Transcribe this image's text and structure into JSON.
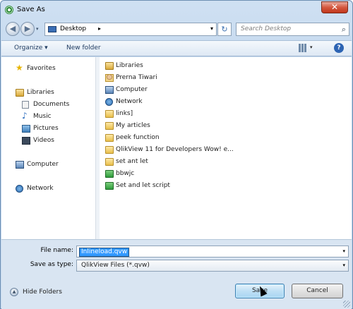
{
  "window": {
    "title": "Save As",
    "close_glyph": "✕"
  },
  "address_bar": {
    "location": "Desktop",
    "breadcrumb_arrow": "▸",
    "dropdown_glyph": "▾",
    "refresh_glyph": "↻",
    "search_placeholder": "Search Desktop",
    "back_glyph": "◀",
    "forward_glyph": "▶"
  },
  "toolbar": {
    "organize_label": "Organize ▾",
    "new_folder_label": "New folder",
    "views_dropdown_glyph": "▾",
    "help_glyph": "?"
  },
  "nav_pane": {
    "favorites": {
      "label": "Favorites",
      "icon": "star-icon"
    },
    "libraries": {
      "label": "Libraries",
      "icon": "library-icon"
    },
    "library_items": [
      {
        "label": "Documents",
        "icon": "documents-icon"
      },
      {
        "label": "Music",
        "icon": "music-icon"
      },
      {
        "label": "Pictures",
        "icon": "pictures-icon"
      },
      {
        "label": "Videos",
        "icon": "videos-icon"
      }
    ],
    "computer": {
      "label": "Computer",
      "icon": "computer-icon"
    },
    "network": {
      "label": "Network",
      "icon": "network-icon"
    }
  },
  "files": [
    {
      "label": "Libraries",
      "icon": "library-icon"
    },
    {
      "label": "Prerna Tiwari",
      "icon": "user-folder-icon"
    },
    {
      "label": "Computer",
      "icon": "computer-icon"
    },
    {
      "label": "Network",
      "icon": "network-icon"
    },
    {
      "label": "links]",
      "icon": "folder-icon"
    },
    {
      "label": "My articles",
      "icon": "folder-icon"
    },
    {
      "label": "peek function",
      "icon": "folder-icon"
    },
    {
      "label": "QlikView 11 for Developers   Wow! e...",
      "icon": "folder-icon"
    },
    {
      "label": "set ant let",
      "icon": "folder-icon"
    },
    {
      "label": "bbwjc",
      "icon": "qvw-file-icon"
    },
    {
      "label": "Set and let script",
      "icon": "qvw-file-icon"
    }
  ],
  "form": {
    "file_name_label": "File name:",
    "file_name_value": "Inlineload.qvw",
    "save_type_label": "Save as type:",
    "save_type_value": "QlikView Files (*.qvw)",
    "dropdown_glyph": "▾"
  },
  "footer": {
    "hide_folders_label": "Hide Folders",
    "hide_folders_glyph": "▲",
    "save_label": "Save",
    "cancel_label": "Cancel"
  },
  "colors": {
    "selection": "#3399ff",
    "window_frame": "#bcd3ec",
    "close_button": "#c1371c"
  }
}
